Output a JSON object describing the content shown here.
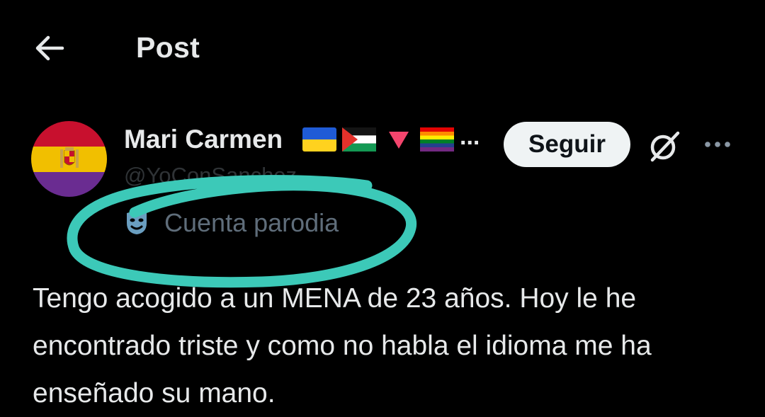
{
  "header": {
    "back_icon": "arrow-left-icon",
    "title": "Post"
  },
  "author": {
    "display_name": "Mari Carmen",
    "name_emojis": [
      "ukraine-flag",
      "palestine-flag",
      "pink-triangle",
      "rainbow-flag"
    ],
    "name_truncation": "...",
    "handle": "@YoConSanchez",
    "parody_icon": "theater-masks-icon",
    "parody_label": "Cuenta parodia",
    "avatar_flag": "spanish-republic-flag"
  },
  "actions": {
    "follow_label": "Seguir",
    "grok_icon": "grok-icon",
    "more_icon": "more-horizontal-icon"
  },
  "post": {
    "text": "Tengo acogido a un MENA de 23 años. Hoy le he encontrado triste y como no habla el idioma me ha enseñado su mano."
  },
  "annotation": {
    "kind": "hand-drawn-circle",
    "color": "#3cc9b8"
  },
  "colors": {
    "background": "#000000",
    "text_primary": "#e7e9ea",
    "text_secondary": "#5f6d7a",
    "follow_bg": "#eff3f4",
    "follow_text": "#0f1419",
    "republic_red": "#c8102e",
    "republic_yellow": "#f1bf00",
    "republic_purple": "#6a2c91"
  }
}
